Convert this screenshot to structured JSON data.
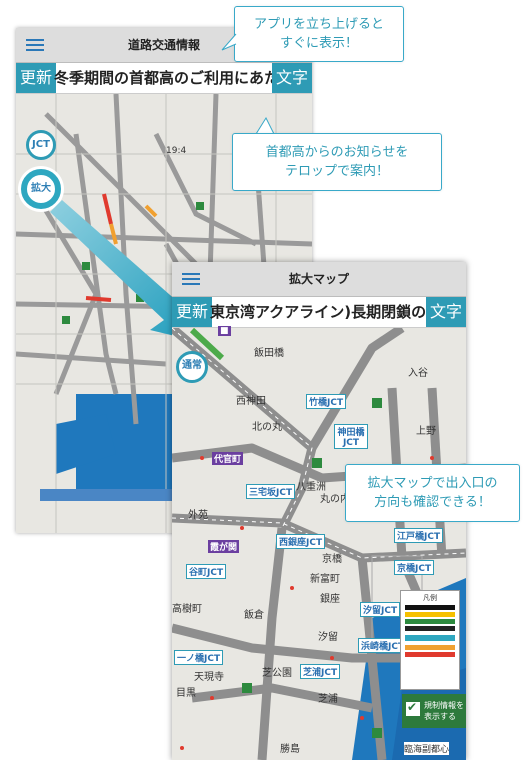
{
  "screen1": {
    "title": "道路交通情報",
    "update_label": "更新",
    "text_label": "文字",
    "ticker": "冬季期間の首都高のご利用にあたっ",
    "time": "19:4",
    "jct_label": "JCT",
    "zoom_label": "拡大"
  },
  "screen2": {
    "title": "拡大マップ",
    "update_label": "更新",
    "text_label": "文字",
    "ticker": "東京湾アクアライン)長期閉鎖のお知",
    "normal_label": "通常",
    "legend_title": "凡例",
    "checkbox_label_line1": "規制情報を",
    "checkbox_label_line2": "表示する"
  },
  "callouts": {
    "c1_line1": "アプリを立ち上げると",
    "c1_line2": "すぐに表示！",
    "c2_line1": "首都高からのお知らせを",
    "c2_line2": "テロップで案内！",
    "c3_line1": "拡大マップで出入口の",
    "c3_line2": "方向も確認できる！"
  },
  "map_labels": {
    "iidabashi": "飯田橋",
    "nishikanda": "西神田",
    "kitanomaru": "北の丸",
    "takebashi_jct": "竹橋JCT",
    "kandabashi_jct": "神田橋JCT",
    "kanda": "神田橋",
    "iriya": "入谷",
    "ueno": "上野",
    "daikanmachi": "代官町",
    "yaesu": "八重洲",
    "miyakezaka_jct": "三宅坂JCT",
    "marunouchi": "丸の内",
    "nishiginza_jct": "西銀座JCT",
    "kyobashi": "京橋",
    "edobashi_jct": "江戸橋JCT",
    "kasumigaseki": "霞が関",
    "shimbashi": "新富町",
    "ginza": "銀座",
    "tanimachi_jct": "谷町JCT",
    "iikura": "飯倉",
    "takagicho": "高樹町",
    "shiodome_jct": "汐留JCT",
    "shiodome": "汐留",
    "hamazakibashi_jct": "浜崎橋JCT",
    "ichinohashi_jct": "一ノ橋JCT",
    "shibakoen": "芝公園",
    "shibaura_jct": "芝浦JCT",
    "tengenji": "天現寺",
    "meguro": "目黒",
    "shibaura": "芝浦",
    "katsushima": "勝島",
    "gaien": "外苑",
    "kyobashi_junction": "京橋JCT",
    "rinkai": "臨海副都心"
  },
  "colors": {
    "accent": "#2e9bb5",
    "road": "#8e8e8e",
    "water": "#1f78bd",
    "jam_red": "#e03a2e",
    "jam_orange": "#f0a030",
    "purple": "#6b3fa0"
  }
}
